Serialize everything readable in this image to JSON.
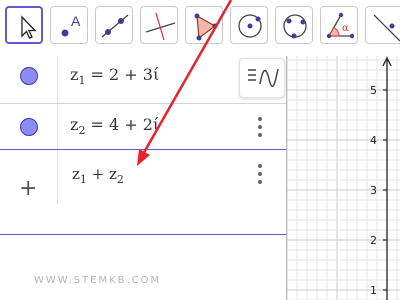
{
  "toolbar": {
    "tools": [
      {
        "name": "move-tool",
        "icon": "pointer-arrow-icon",
        "active": true
      },
      {
        "name": "point-tool",
        "icon": "point-icon",
        "active": false
      },
      {
        "name": "line-tool",
        "icon": "line-icon",
        "active": false
      },
      {
        "name": "perpendicular-line-tool",
        "icon": "perpendicular-line-icon",
        "active": false
      },
      {
        "name": "polygon-tool",
        "icon": "polygon-icon",
        "active": false
      },
      {
        "name": "circle-center-point-tool",
        "icon": "circle-center-icon",
        "active": false
      },
      {
        "name": "circle-three-points-tool",
        "icon": "circle-three-points-icon",
        "active": false
      },
      {
        "name": "angle-tool",
        "icon": "angle-icon",
        "active": false
      },
      {
        "name": "reflect-tool",
        "icon": "reflect-line-icon",
        "active": false
      }
    ],
    "angle_symbol": "α",
    "point_label": "A"
  },
  "algebra": {
    "rows": [
      {
        "var": "z",
        "sub": "1",
        "rest": " = 2 + 3ί"
      },
      {
        "var": "z",
        "sub": "2",
        "rest": " = 4 + 2ί"
      }
    ],
    "input": {
      "a": "z",
      "a_sub": "1",
      "op": " + ",
      "b": "z",
      "b_sub": "2"
    },
    "add_symbol": "+",
    "watermark": "WWW.STEMKB.COM"
  },
  "graphics": {
    "y_ticks": [
      "5",
      "4",
      "3",
      "2",
      "1"
    ]
  },
  "colors": {
    "accent": "#6557d2",
    "marble_fill": "#8c8cf0",
    "arrow": "#e8222a",
    "grid_minor": "#e6e6e6",
    "grid_major": "#c8c8c8"
  }
}
